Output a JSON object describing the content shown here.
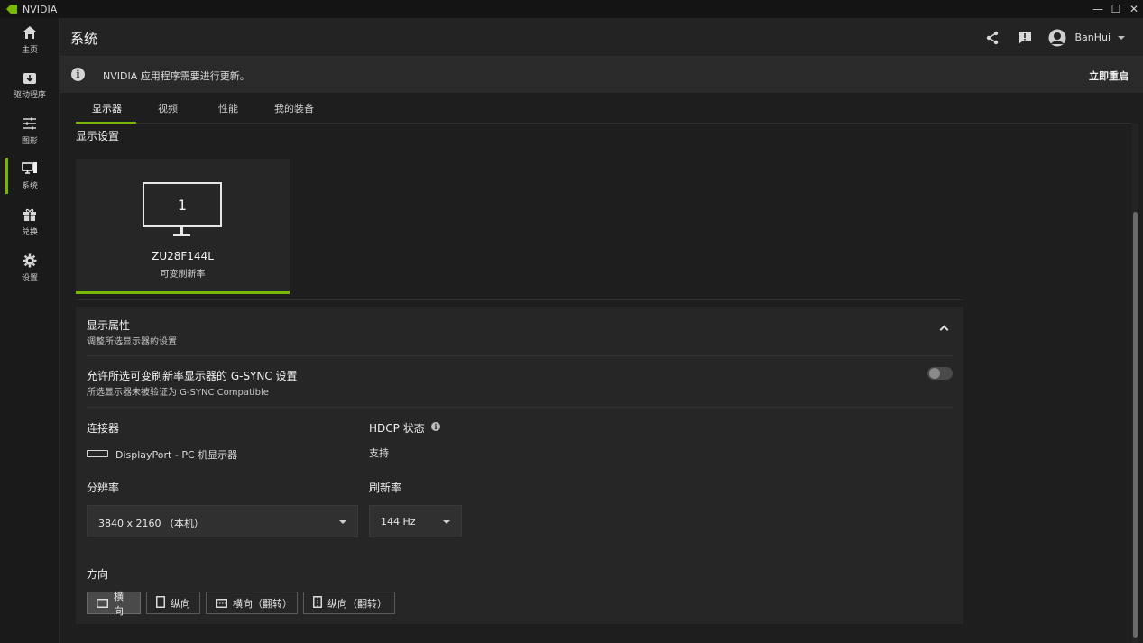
{
  "window": {
    "app_name": "NVIDIA",
    "minimize": "—",
    "maximize": "☐",
    "close": "✕"
  },
  "sidebar": {
    "items": [
      {
        "label": "主页",
        "icon": "home-icon"
      },
      {
        "label": "驱动程序",
        "icon": "driver-icon"
      },
      {
        "label": "图形",
        "icon": "sliders-icon"
      },
      {
        "label": "系统",
        "icon": "system-icon",
        "active": true
      },
      {
        "label": "兑换",
        "icon": "gift-icon"
      },
      {
        "label": "设置",
        "icon": "gear-icon"
      }
    ]
  },
  "header": {
    "title": "系统",
    "username": "BanHui"
  },
  "notice": {
    "message": "NVIDIA 应用程序需要进行更新。",
    "action": "立即重启"
  },
  "tabs": [
    "显示器",
    "视频",
    "性能",
    "我的装备"
  ],
  "display_settings": {
    "title": "显示设置",
    "monitor": {
      "number": "1",
      "name": "ZU28F144L",
      "subtitle": "可变刷新率"
    }
  },
  "properties": {
    "title": "显示属性",
    "subtitle": "调整所选显示器的设置",
    "gsync_title": "允许所选可变刷新率显示器的 G-SYNC 设置",
    "gsync_sub": "所选显示器未被验证为 G-SYNC Compatible",
    "gsync_enabled": false,
    "connector_label": "连接器",
    "connector_value": "DisplayPort - PC 机显示器",
    "hdcp_label": "HDCP 状态",
    "hdcp_value": "支持",
    "resolution_label": "分辨率",
    "resolution_value": "3840 x 2160 （本机）",
    "refresh_label": "刷新率",
    "refresh_value": "144 Hz",
    "orientation_label": "方向",
    "orientations": [
      "横向",
      "纵向",
      "横向（翻转）",
      "纵向（翻转）"
    ]
  },
  "colors": {
    "accent": "#76b900",
    "background": "#1e1e1e",
    "panel": "#262626"
  }
}
